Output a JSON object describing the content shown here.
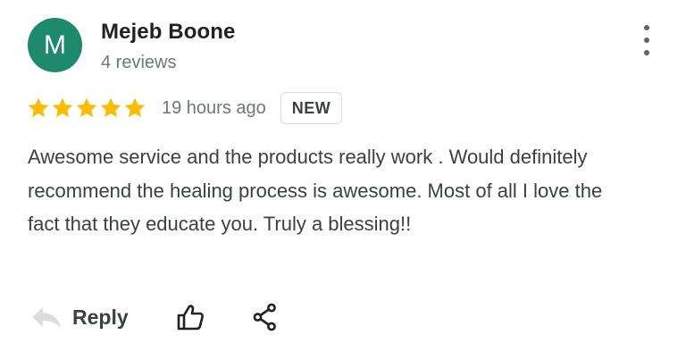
{
  "review": {
    "author": {
      "initial": "M",
      "name": "Mejeb Boone",
      "review_count": "4 reviews",
      "avatar_color": "#1e8a6d"
    },
    "rating": 5,
    "rating_max": 5,
    "star_color": "#fbbc04",
    "time_ago": "19 hours ago",
    "badge": "NEW",
    "text": "Awesome service and the products really work . Would definitely recommend the healing process is awesome. Most of all I love the fact that they educate you. Truly a blessing!!"
  },
  "actions": {
    "reply_label": "Reply",
    "reply_icon": "reply-arrow-icon",
    "like_icon": "thumbs-up-icon",
    "share_icon": "share-icon",
    "more_icon": "more-vertical-icon"
  }
}
